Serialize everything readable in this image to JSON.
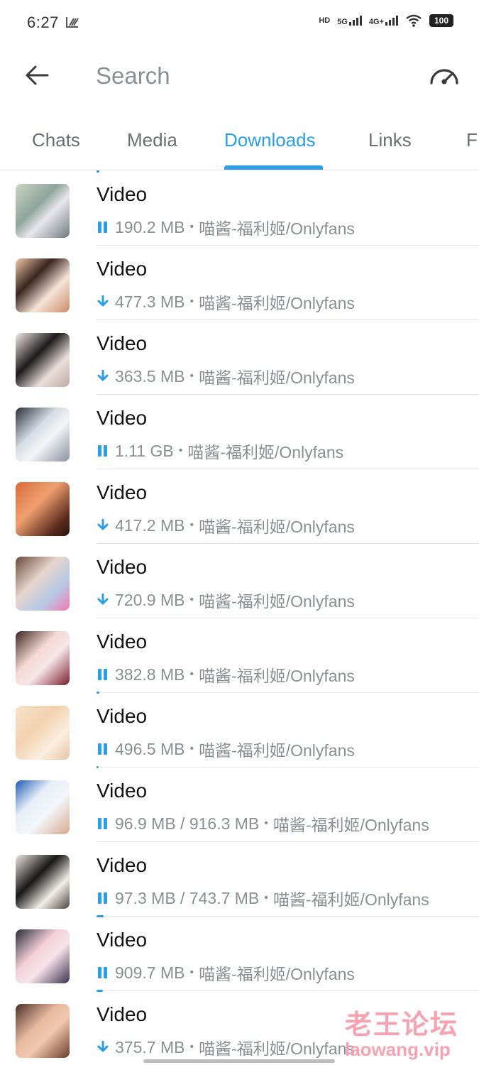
{
  "status_bar": {
    "time": "6:27",
    "hd": "HD",
    "net_5g": "5G",
    "net_4g": "4G+",
    "battery": "100"
  },
  "search": {
    "placeholder": "Search"
  },
  "tabs": [
    {
      "label": "Chats"
    },
    {
      "label": "Media"
    },
    {
      "label": "Downloads",
      "active": true
    },
    {
      "label": "Links"
    },
    {
      "label": "F"
    }
  ],
  "accent_color": "#2a9ee6",
  "downloads": [
    {
      "title": "Video",
      "size": "190.2 MB",
      "source": "喵酱-福利姬/Onlyfans",
      "status": "paused"
    },
    {
      "title": "Video",
      "size": "477.3 MB",
      "source": "喵酱-福利姬/Onlyfans",
      "status": "queued"
    },
    {
      "title": "Video",
      "size": "363.5 MB",
      "source": "喵酱-福利姬/Onlyfans",
      "status": "queued"
    },
    {
      "title": "Video",
      "size": "1.11 GB",
      "source": "喵酱-福利姬/Onlyfans",
      "status": "paused"
    },
    {
      "title": "Video",
      "size": "417.2 MB",
      "source": "喵酱-福利姬/Onlyfans",
      "status": "queued"
    },
    {
      "title": "Video",
      "size": "720.9 MB",
      "source": "喵酱-福利姬/Onlyfans",
      "status": "queued"
    },
    {
      "title": "Video",
      "size": "382.8 MB",
      "source": "喵酱-福利姬/Onlyfans",
      "status": "paused"
    },
    {
      "title": "Video",
      "size": "496.5 MB",
      "source": "喵酱-福利姬/Onlyfans",
      "status": "paused"
    },
    {
      "title": "Video",
      "size": "96.9 MB / 916.3 MB",
      "source": "喵酱-福利姬/Onlyfans",
      "status": "paused"
    },
    {
      "title": "Video",
      "size": "97.3 MB / 743.7 MB",
      "source": "喵酱-福利姬/Onlyfans",
      "status": "paused"
    },
    {
      "title": "Video",
      "size": "909.7 MB",
      "source": "喵酱-福利姬/Onlyfans",
      "status": "paused"
    },
    {
      "title": "Video",
      "size": "375.7 MB",
      "source": "喵酱-福利姬/Onlyfans",
      "status": "queued"
    }
  ],
  "watermark": {
    "line1": "老王论坛",
    "line2": "laowang.vip"
  }
}
